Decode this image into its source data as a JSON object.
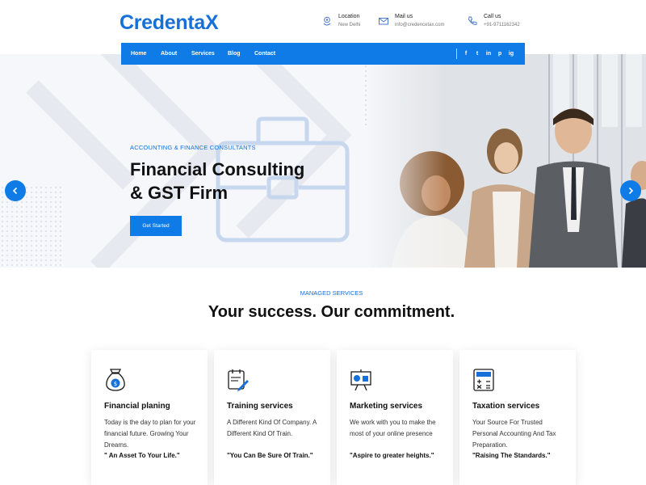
{
  "brand": {
    "logo": "CredentaX",
    "accent": "#0f7be6"
  },
  "header": {
    "location": {
      "title": "Location",
      "value": "New Delhi",
      "icon": "location-pin-icon"
    },
    "mail": {
      "title": "Mail us",
      "value": "info@credencetax.com",
      "icon": "envelope-icon"
    },
    "call": {
      "title": "Call us",
      "value": "+91-9711162342",
      "icon": "phone-icon"
    }
  },
  "nav": {
    "items": [
      "Home",
      "About",
      "Services",
      "Blog",
      "Contact"
    ],
    "social": [
      "f",
      "t",
      "in",
      "p",
      "ig"
    ]
  },
  "hero": {
    "eyebrow": "ACCOUNTING & FINANCE CONSULTANTS",
    "headline_line1": "Financial Consulting",
    "headline_line2": "& GST Firm",
    "cta": "Get Started"
  },
  "section": {
    "eyebrow": "MANAGED SERVICES",
    "title": "Your success. Our commitment."
  },
  "cards": [
    {
      "title": "Financial planing",
      "desc": "Today is the day to plan for your financial future. Growing Your Dreams.",
      "tag": "\" An Asset To Your Life.\"",
      "icon": "money-bag-icon"
    },
    {
      "title": "Training services",
      "desc": "A Different Kind Of Company. A Different Kind Of Train.",
      "tag": "\"You Can Be Sure Of Train.\"",
      "icon": "calendar-pencil-icon"
    },
    {
      "title": "Marketing services",
      "desc": "We work with you to make the most of your online presence",
      "tag": "\"Aspire to greater heights.\"",
      "icon": "presentation-board-icon"
    },
    {
      "title": "Taxation services",
      "desc": "Your Source For Trusted Personal Accounting And Tax Preparation.",
      "tag": "\"Raising The Standards.\"",
      "icon": "calculator-icon"
    }
  ]
}
